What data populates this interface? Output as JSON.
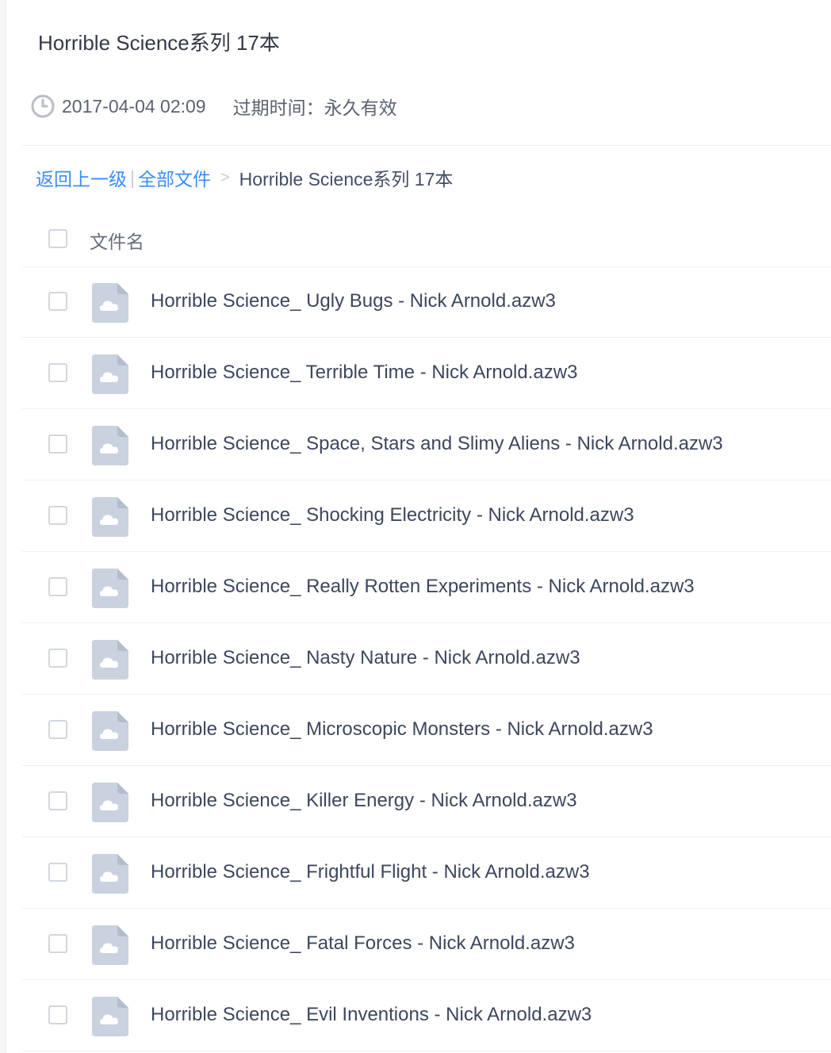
{
  "share": {
    "title": "Horrible Science系列 17本",
    "date": "2017-04-04 02:09",
    "expire_label": "过期时间：",
    "expire_value": "永久有效"
  },
  "breadcrumb": {
    "back": "返回上一级",
    "separator": "|",
    "all_files": "全部文件",
    "arrow": ">",
    "current": "Horrible Science系列 17本"
  },
  "table": {
    "header": "文件名"
  },
  "files": [
    "Horrible Science_ Ugly Bugs - Nick Arnold.azw3",
    "Horrible Science_ Terrible Time - Nick Arnold.azw3",
    "Horrible Science_ Space, Stars and Slimy Aliens - Nick Arnold.azw3",
    "Horrible Science_ Shocking Electricity - Nick Arnold.azw3",
    "Horrible Science_ Really Rotten Experiments - Nick Arnold.azw3",
    "Horrible Science_ Nasty Nature - Nick Arnold.azw3",
    "Horrible Science_ Microscopic Monsters - Nick Arnold.azw3",
    "Horrible Science_ Killer Energy - Nick Arnold.azw3",
    "Horrible Science_ Frightful Flight - Nick Arnold.azw3",
    "Horrible Science_ Fatal Forces - Nick Arnold.azw3",
    "Horrible Science_ Evil Inventions - Nick Arnold.azw3"
  ],
  "colors": {
    "link": "#3b8cff",
    "text": "#424e67",
    "icon": "#c9d2de"
  }
}
